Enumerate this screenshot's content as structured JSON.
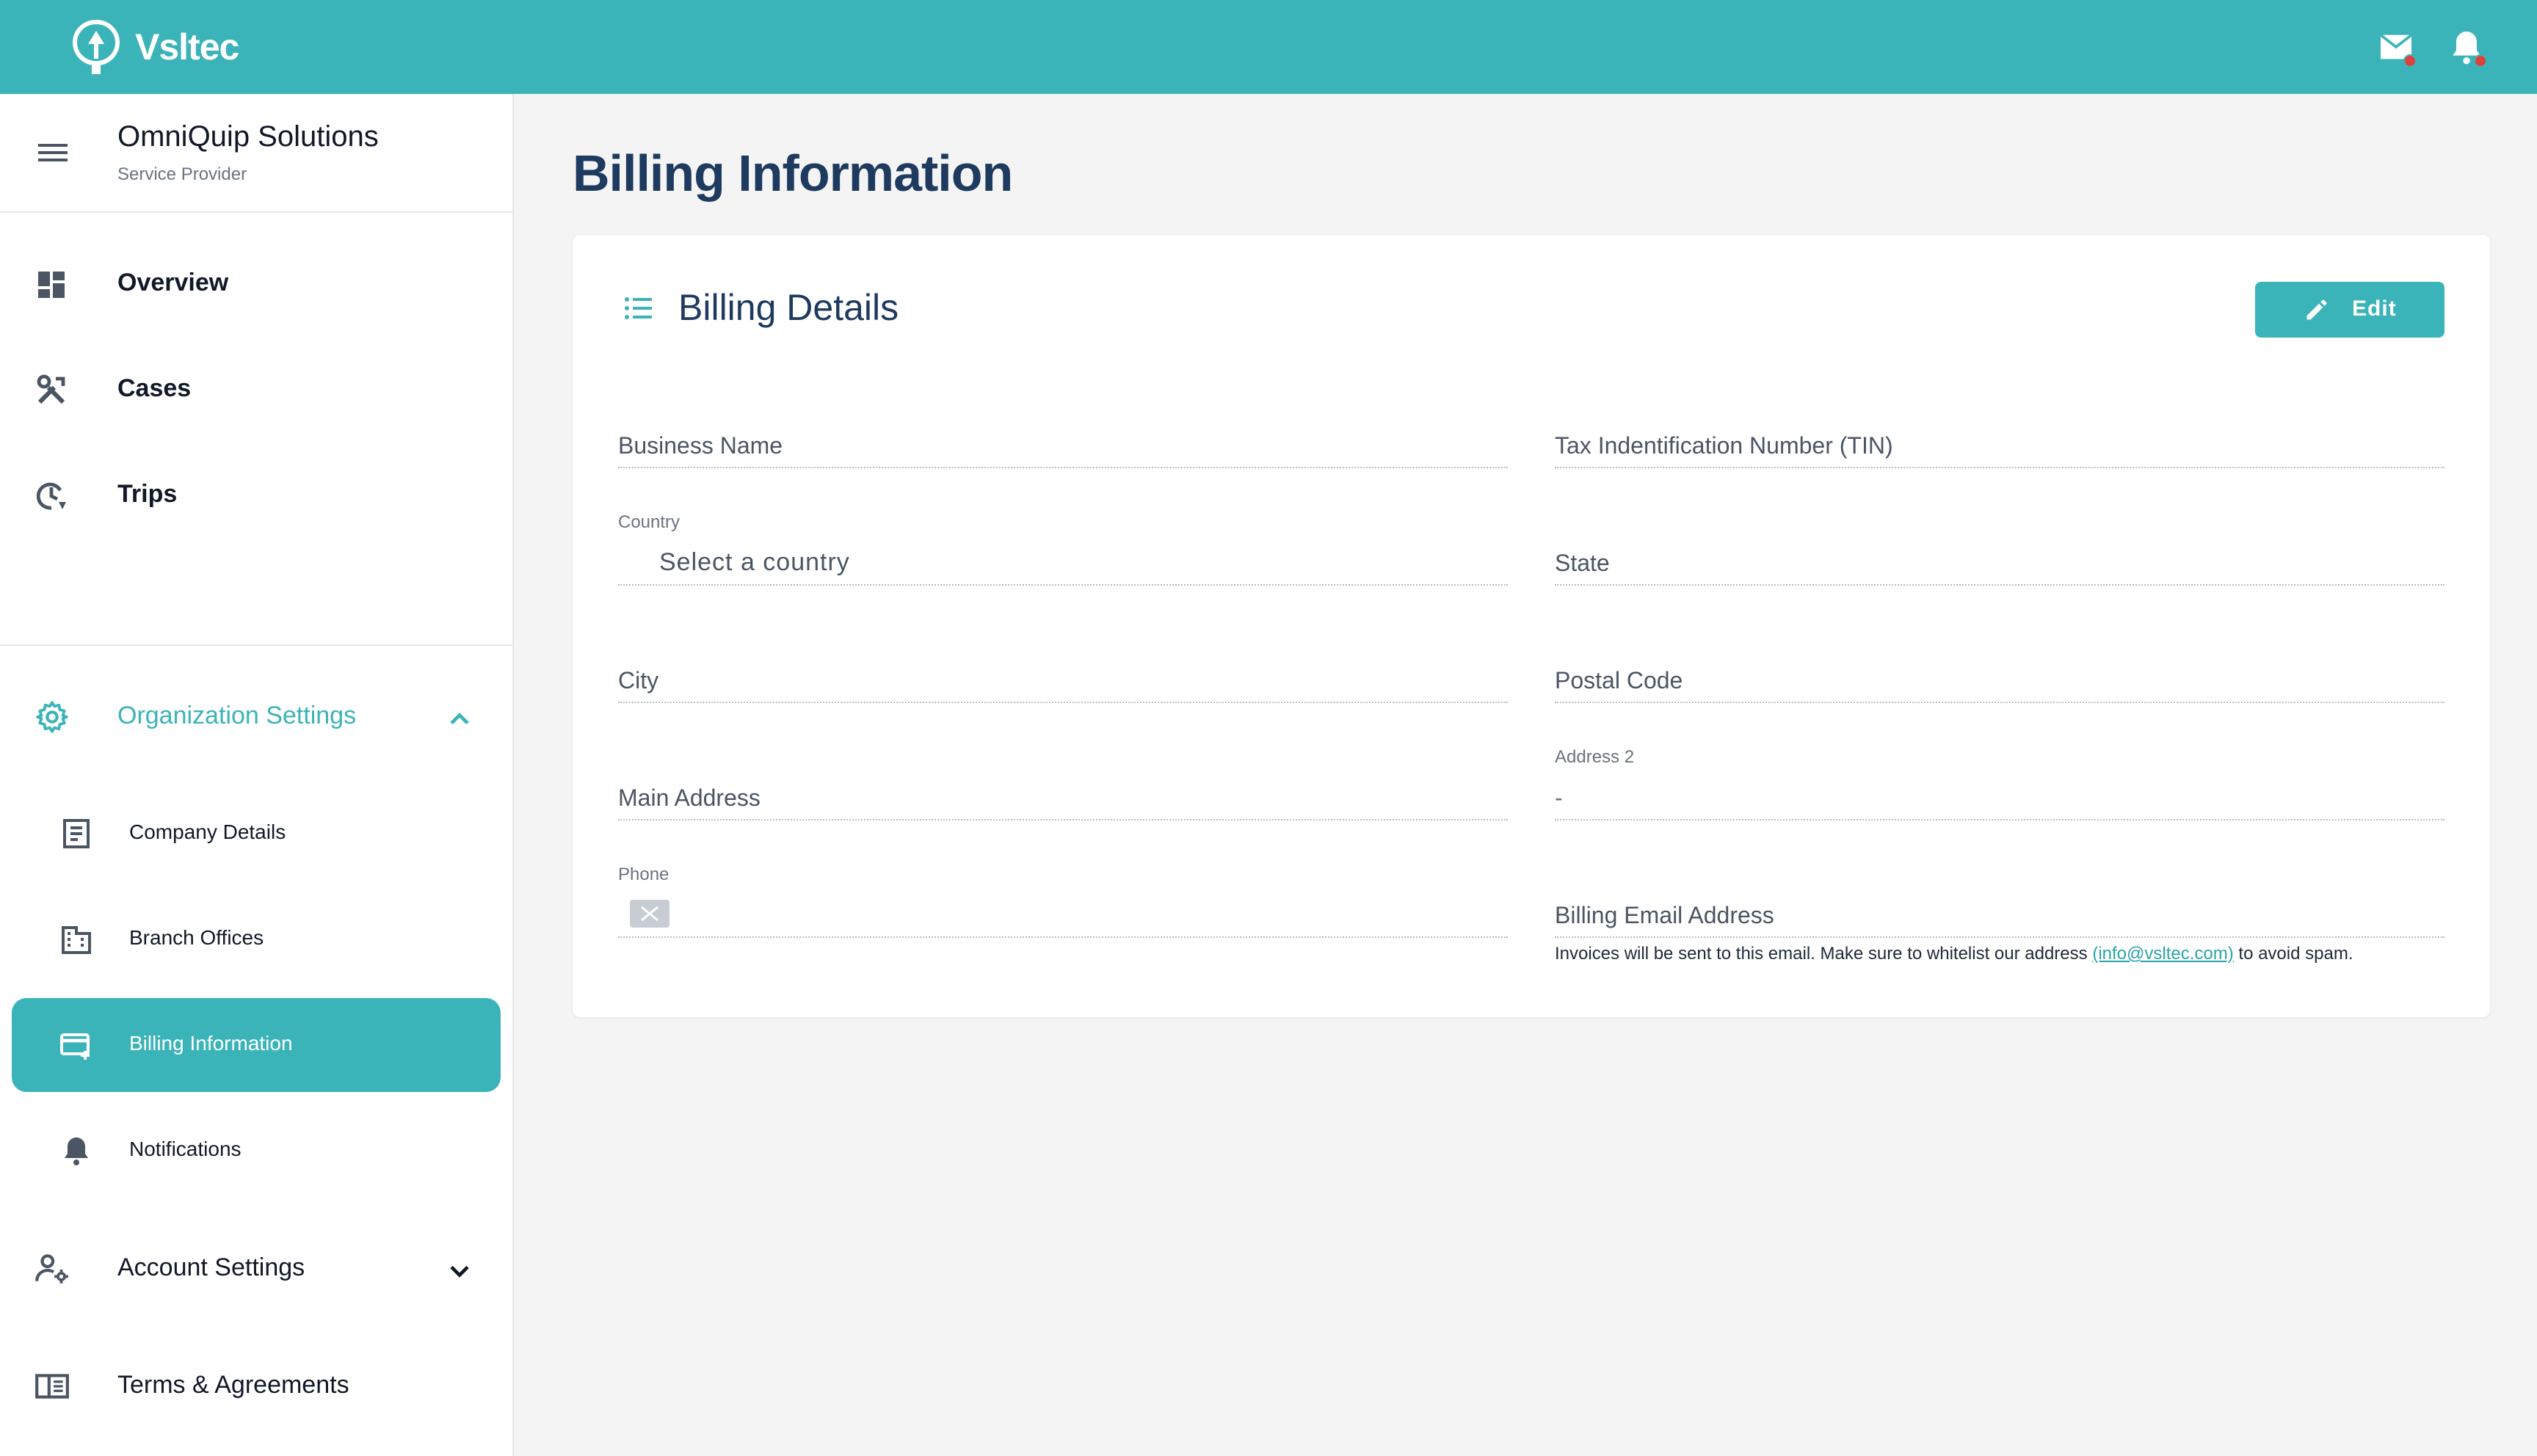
{
  "app": {
    "brand": "Vsltec"
  },
  "colors": {
    "accent": "#3bb4b9",
    "title": "#1e3a5f",
    "badge": "#e0413c"
  },
  "topbar": {
    "icons": [
      "mail-icon",
      "bell-icon"
    ]
  },
  "sidebar": {
    "org_name": "OmniQuip Solutions",
    "org_role": "Service Provider",
    "main_items": [
      {
        "label": "Overview",
        "icon": "dashboard-icon"
      },
      {
        "label": "Cases",
        "icon": "tools-icon"
      },
      {
        "label": "Trips",
        "icon": "trip-icon"
      }
    ],
    "org_settings": {
      "label": "Organization Settings",
      "expanded": true,
      "items": [
        {
          "label": "Company Details",
          "icon": "document-icon"
        },
        {
          "label": "Branch Offices",
          "icon": "building-icon"
        },
        {
          "label": "Billing Information",
          "icon": "credit-card-icon",
          "active": true
        },
        {
          "label": "Notifications",
          "icon": "bell-icon"
        }
      ]
    },
    "account_settings": {
      "label": "Account Settings",
      "expanded": false
    },
    "terms": {
      "label": "Terms & Agreements"
    }
  },
  "main": {
    "page_title": "Billing Information",
    "card_title": "Billing Details",
    "edit_label": "Edit",
    "fields": {
      "business_name": {
        "placeholder": "Business Name"
      },
      "tin": {
        "placeholder": "Tax Indentification Number (TIN)"
      },
      "country": {
        "label": "Country",
        "placeholder": "Select a country"
      },
      "state": {
        "placeholder": "State"
      },
      "city": {
        "placeholder": "City"
      },
      "postal_code": {
        "placeholder": "Postal Code"
      },
      "main_address": {
        "placeholder": "Main Address"
      },
      "address2": {
        "label": "Address 2",
        "value": "-"
      },
      "phone": {
        "label": "Phone"
      },
      "billing_email": {
        "placeholder": "Billing Email Address"
      }
    },
    "helper": {
      "before": "Invoices will be sent to this email. Make sure to whitelist our address ",
      "link": "(info@vsltec.com)",
      "after": " to avoid spam."
    }
  }
}
